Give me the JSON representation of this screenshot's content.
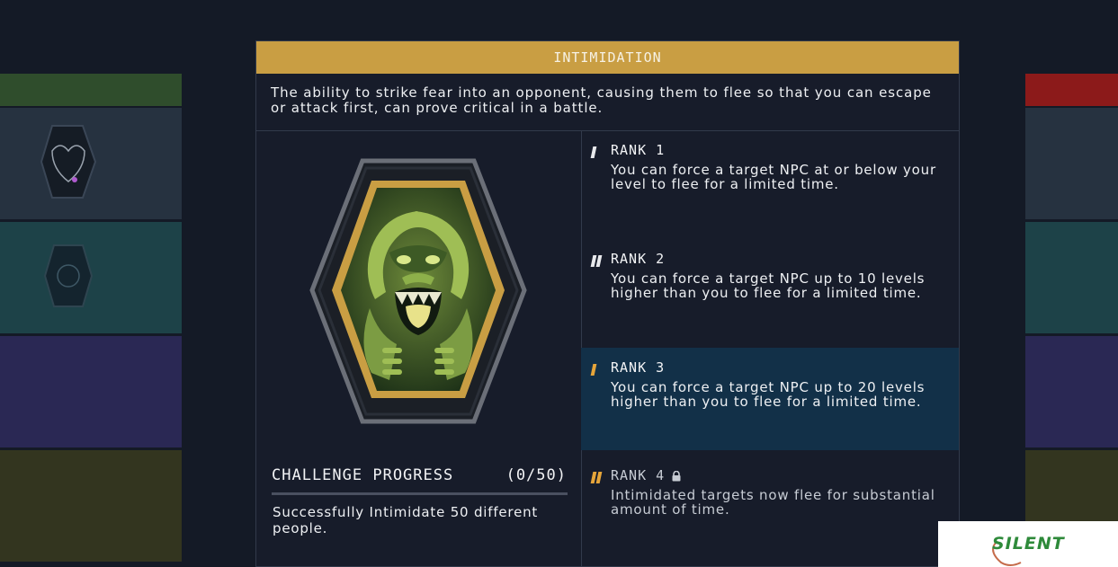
{
  "perk": {
    "title": "INTIMIDATION",
    "description": "The ability to strike fear into an opponent, causing them to flee so that you can escape or attack first, can prove critical in a battle.",
    "badge_icon": "gorilla-badge-icon"
  },
  "challenge": {
    "title": "CHALLENGE PROGRESS",
    "count": "(0/50)",
    "progress": 0,
    "description": "Successfully Intimidate 50 different people."
  },
  "ranks": [
    {
      "label": "RANK 1",
      "text": "You can force a target NPC at or below your level to flee for a limited time.",
      "state": "unlocked"
    },
    {
      "label": "RANK 2",
      "text": "You can force a target NPC up to 10 levels higher than you to flee for a limited time.",
      "state": "unlocked"
    },
    {
      "label": "RANK 3",
      "text": "You can force a target NPC up to 20 levels higher than you to flee for a limited time.",
      "state": "selected"
    },
    {
      "label": "RANK 4",
      "text": "Intimidated targets now flee for substantial amount of time.",
      "state": "locked"
    }
  ],
  "watermark": {
    "text": "SILENT"
  },
  "colors": {
    "accent_gold": "#c99e43",
    "selected_row": "#123048",
    "background": "#141a26"
  }
}
